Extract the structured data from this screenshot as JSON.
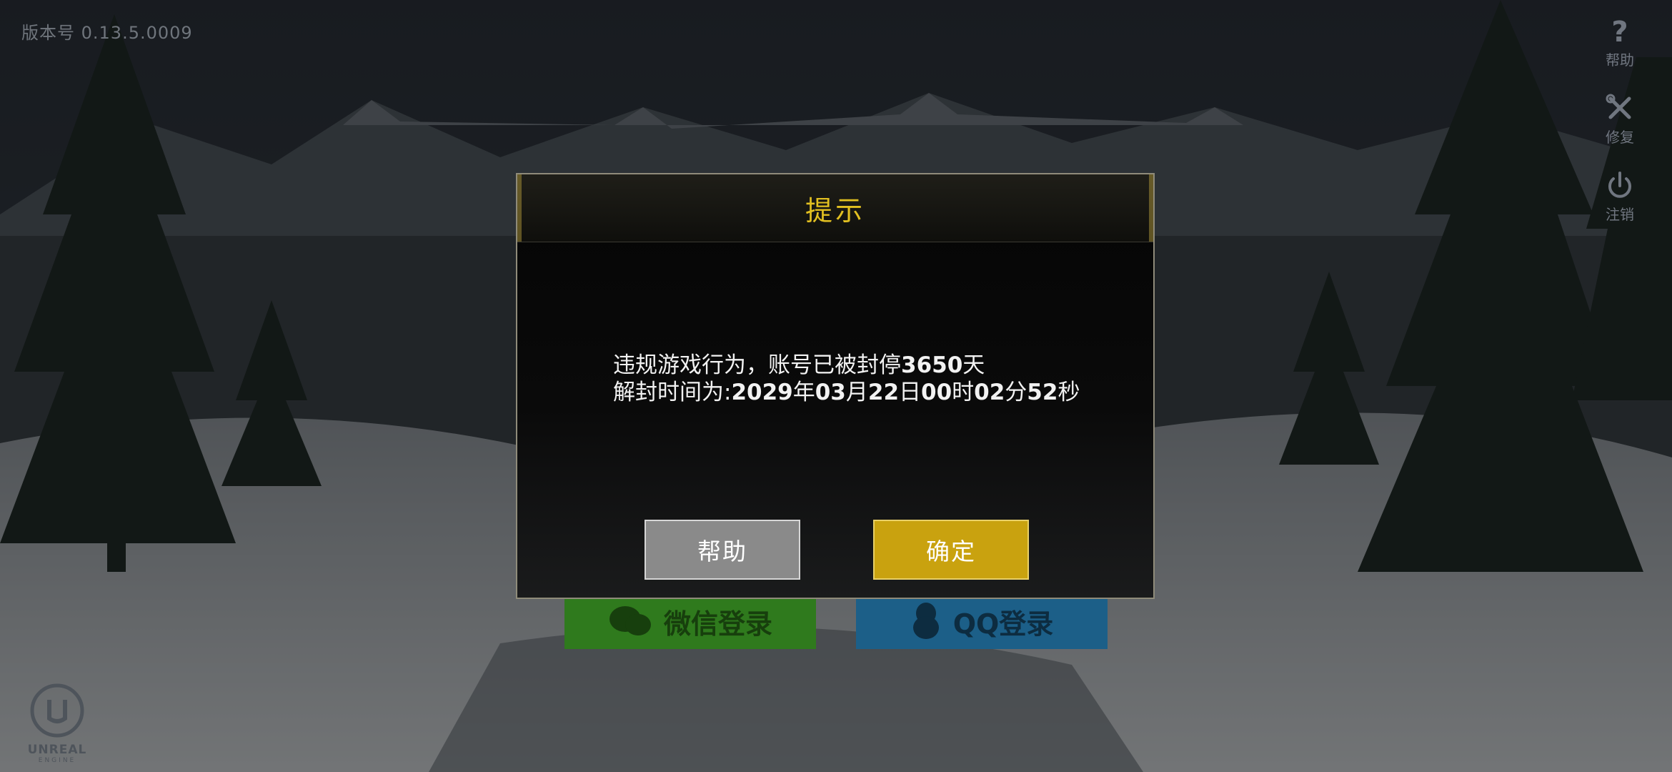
{
  "version_label": "版本号 0.13.5.0009",
  "side_menu": [
    {
      "label": "帮助",
      "icon": "question-icon"
    },
    {
      "label": "修复",
      "icon": "wrench-icon"
    },
    {
      "label": "注销",
      "icon": "power-icon"
    }
  ],
  "login": {
    "wechat_label": "微信登录",
    "qq_label": "QQ登录"
  },
  "engine_logo": {
    "name": "UNREAL",
    "sub": "ENGINE"
  },
  "dialog": {
    "title": "提示",
    "line1_text": "违规游戏行为，账号已被封停",
    "ban_days": "3650",
    "line1_suffix": "天",
    "line2_prefix": "解封时间为:",
    "year": "2029",
    "year_unit": "年",
    "month": "03",
    "month_unit": "月",
    "day": "22",
    "day_unit": "日",
    "hour": "00",
    "hour_unit": "时",
    "minute": "02",
    "minute_unit": "分",
    "second": "52",
    "second_unit": "秒",
    "help_button": "帮助",
    "ok_button": "确定"
  },
  "colors": {
    "title_gold": "#e2c021",
    "ok_button": "#c9a20f",
    "help_button": "#8a8a8a",
    "wechat_green": "#2f7a1d",
    "qq_blue": "#1c5f88"
  }
}
